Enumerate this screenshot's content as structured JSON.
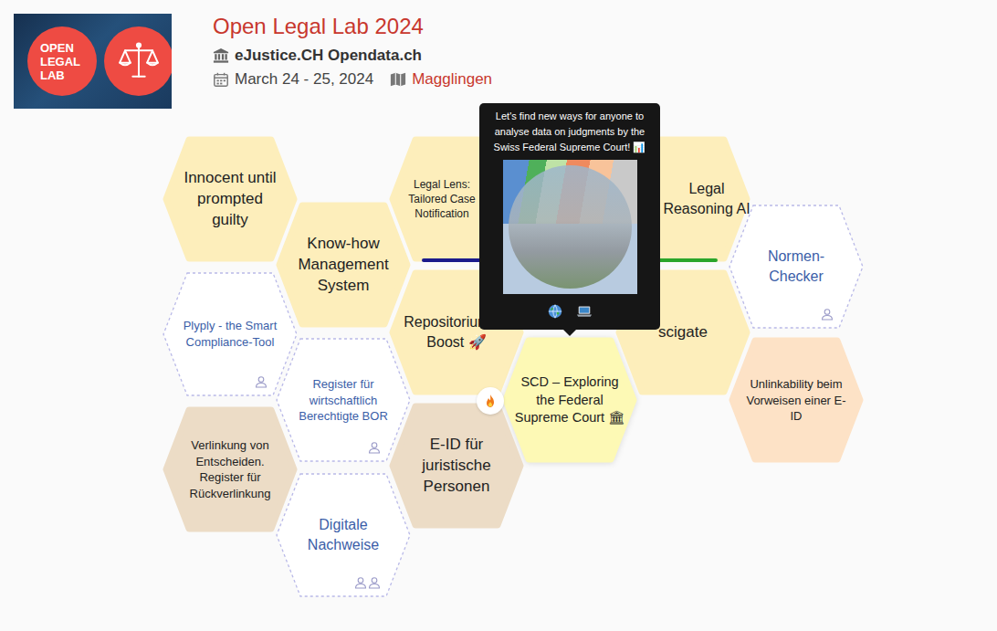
{
  "event": {
    "logo_text": [
      "OPEN",
      "LEGAL",
      "LAB"
    ],
    "title": "Open Legal Lab 2024",
    "organizers": "eJustice.CH Opendata.ch",
    "dates": "March 24 - 25, 2024",
    "location": "Magglingen"
  },
  "projects": [
    {
      "title": "Innocent until prompted guilty",
      "kind": "project",
      "color": "#fdeebb",
      "bar_color": null,
      "team_size": 0,
      "hot": false,
      "selected": false
    },
    {
      "title": "Know-how Management System",
      "kind": "project",
      "color": "#fdeebb",
      "bar_color": null,
      "team_size": 0,
      "hot": false,
      "selected": false
    },
    {
      "title": "Legal Lens: Tailored Case Notification",
      "kind": "project",
      "color": "#fdeebb",
      "bar_color": "#1a1a8c",
      "team_size": 0,
      "hot": false,
      "selected": false
    },
    {
      "title": "Legal Reasoning AI",
      "kind": "project",
      "color": "#fdeebb",
      "bar_color": "#2aa52a",
      "team_size": 0,
      "hot": false,
      "selected": false
    },
    {
      "title": "Normen-Checker",
      "kind": "idea",
      "color": "#ffffff",
      "bar_color": null,
      "team_size": 1,
      "hot": false,
      "selected": false
    },
    {
      "title": "Plyply - the Smart Compliance-Tool",
      "kind": "idea",
      "color": "#ffffff",
      "bar_color": null,
      "team_size": 1,
      "hot": false,
      "selected": false
    },
    {
      "title": "Register für wirtschaftlich Berechtigte BOR",
      "kind": "idea",
      "color": "#ffffff",
      "bar_color": null,
      "team_size": 1,
      "hot": false,
      "selected": false
    },
    {
      "title": "Repositorium.ch Boost 🚀",
      "kind": "project",
      "color": "#fdeebb",
      "bar_color": null,
      "team_size": 0,
      "hot": false,
      "selected": false
    },
    {
      "title": "SCD – Exploring the Federal Supreme Court 🏛",
      "kind": "project",
      "color": "#fdf9b5",
      "bar_color": null,
      "team_size": 0,
      "hot": true,
      "selected": true
    },
    {
      "title": "scigate",
      "kind": "project",
      "color": "#fdeebb",
      "bar_color": null,
      "team_size": 0,
      "hot": false,
      "selected": false
    },
    {
      "title": "Unlinkability beim Vorweisen einer E-ID",
      "kind": "project",
      "color": "#fde2c6",
      "bar_color": null,
      "team_size": 0,
      "hot": false,
      "selected": false
    },
    {
      "title": "Verlinkung von Entscheiden. Register für Rückverlinkung",
      "kind": "project",
      "color": "#ecdcc6",
      "bar_color": null,
      "team_size": 0,
      "hot": false,
      "selected": false
    },
    {
      "title": "Digitale Nachweise",
      "kind": "idea",
      "color": "#ffffff",
      "bar_color": null,
      "team_size": 2,
      "hot": false,
      "selected": false
    },
    {
      "title": "E-ID für juristische Personen",
      "kind": "project",
      "color": "#ecdcc6",
      "bar_color": null,
      "team_size": 0,
      "hot": false,
      "selected": false
    }
  ],
  "tooltip": {
    "text": "Let's find new ways for anyone to analyse data on judgments by the Swiss Federal Supreme Court! 📊"
  }
}
